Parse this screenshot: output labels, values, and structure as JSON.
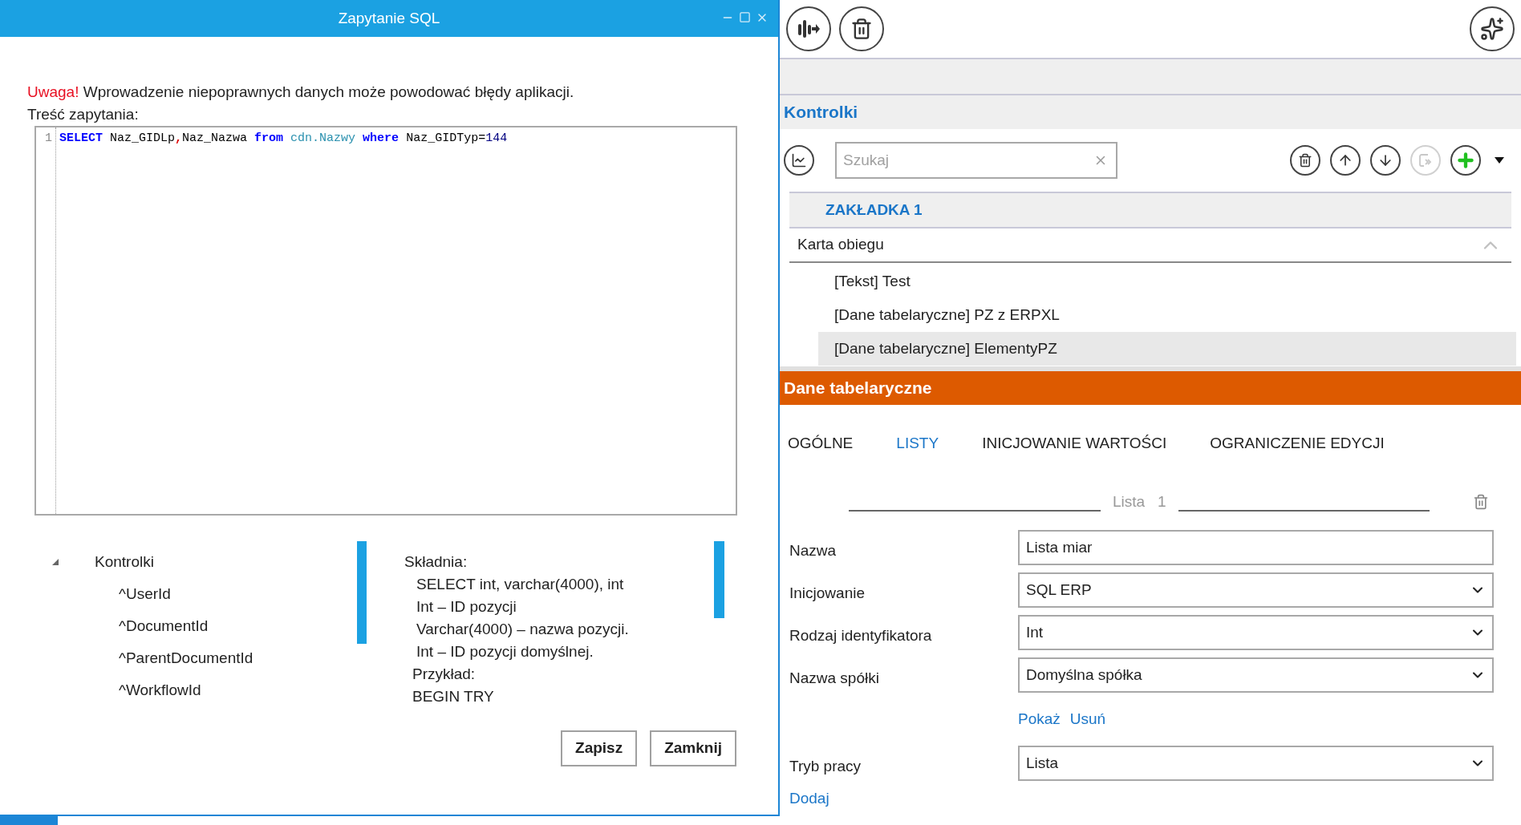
{
  "dialog": {
    "title": "Zapytanie SQL",
    "warning": {
      "label": "Uwaga!",
      "text": "Wprowadzenie niepoprawnych danych może powodować błędy aplikacji."
    },
    "query_label": "Treść zapytania:",
    "editor": {
      "lines": [
        {
          "number": "1",
          "tokens": [
            {
              "text": "SELECT",
              "kind": "keyword"
            },
            {
              "text": " Naz_GIDLp",
              "kind": "plain"
            },
            {
              "text": ",",
              "kind": "punct"
            },
            {
              "text": "Naz_Nazwa ",
              "kind": "plain"
            },
            {
              "text": "from",
              "kind": "keyword"
            },
            {
              "text": " cdn.Nazwy ",
              "kind": "object"
            },
            {
              "text": "where",
              "kind": "keyword"
            },
            {
              "text": " Naz_GIDTyp=",
              "kind": "plain"
            },
            {
              "text": "144",
              "kind": "number"
            }
          ]
        }
      ]
    },
    "tree": {
      "label": "Kontrolki",
      "expanded": true,
      "children": [
        {
          "label": "^UserId"
        },
        {
          "label": "^DocumentId"
        },
        {
          "label": "^ParentDocumentId"
        },
        {
          "label": "^WorkflowId"
        }
      ]
    },
    "help_lines": [
      {
        "text": "Składnia:",
        "indent": false
      },
      {
        "text": "SELECT int, varchar(4000), int",
        "indent": true
      },
      {
        "text": "Int – ID pozycji",
        "indent": true
      },
      {
        "text": "Varchar(4000) – nazwa pozycji.",
        "indent": true
      },
      {
        "text": "Int – ID pozycji domyślnej.",
        "indent": true
      },
      {
        "text": "Przykład:",
        "indent": false
      },
      {
        "text": "BEGIN TRY",
        "indent": false
      }
    ],
    "buttons": [
      "Zapisz",
      "Zamknij"
    ]
  },
  "panel": {
    "section_title": "Kontrolki",
    "search": {
      "placeholder": "Szukaj"
    },
    "list_tools": [
      {
        "kind": "delete",
        "disabled": false
      },
      {
        "kind": "up",
        "disabled": false
      },
      {
        "kind": "down",
        "disabled": false
      },
      {
        "kind": "copy",
        "disabled": true
      },
      {
        "kind": "add",
        "disabled": false
      }
    ],
    "tab_group": "ZAKŁADKA 1",
    "group": {
      "label": "Karta obiegu",
      "expanded": true,
      "items": [
        {
          "label": "[Tekst] Test",
          "selected": false
        },
        {
          "label": "[Dane tabelaryczne] PZ z ERPXL",
          "selected": false
        },
        {
          "label": "[Dane tabelaryczne] ElementyPZ",
          "selected": true
        }
      ]
    },
    "properties_title": "Dane tabelaryczne",
    "tabs": [
      {
        "label": "OGÓLNE",
        "selected": false
      },
      {
        "label": "LISTY",
        "selected": true
      },
      {
        "label": "INICJOWANIE WARTOŚCI",
        "selected": false
      },
      {
        "label": "OGRANICZENIE EDYCJI",
        "selected": false
      }
    ],
    "list_header": {
      "label": "Lista",
      "number": "1"
    },
    "fields": [
      {
        "kind": "text",
        "label": "Nazwa",
        "value": "Lista miar"
      },
      {
        "kind": "select",
        "label": "Inicjowanie",
        "value": "SQL ERP"
      },
      {
        "kind": "select",
        "label": "Rodzaj identyfikatora",
        "value": "Int"
      },
      {
        "kind": "select",
        "label": "Nazwa spółki",
        "value": "Domyślna spółka"
      },
      {
        "kind": "links",
        "links": [
          "Pokaż",
          "Usuń"
        ]
      },
      {
        "kind": "select",
        "label": "Tryb pracy",
        "value": "Lista"
      }
    ],
    "add_link": "Dodaj"
  }
}
